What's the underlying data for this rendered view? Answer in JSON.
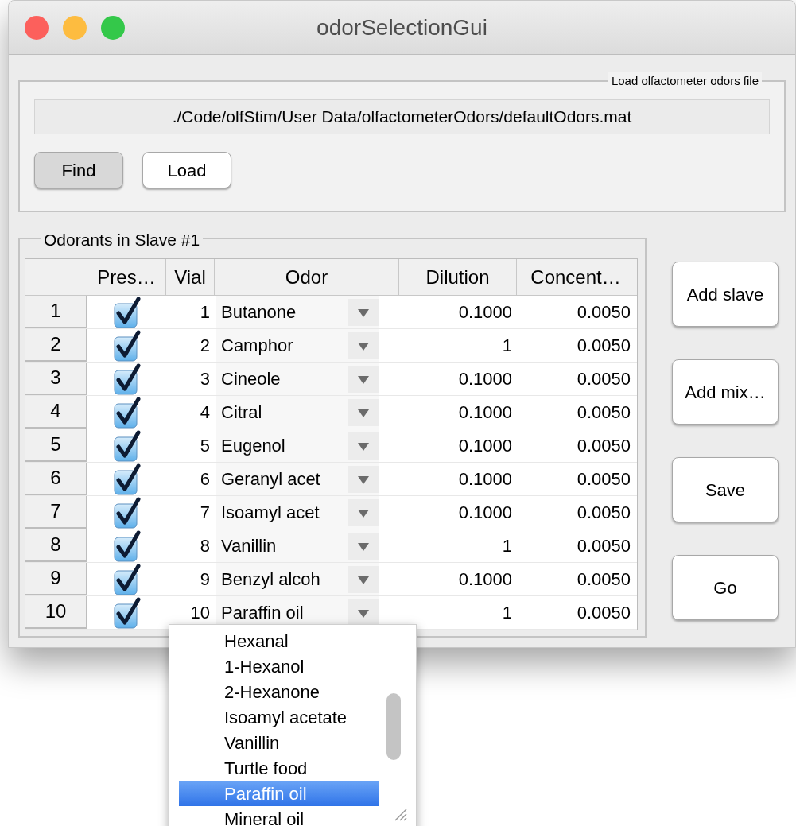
{
  "window": {
    "title": "odorSelectionGui"
  },
  "file_panel": {
    "title": "Load olfactometer odors file",
    "path": "./Code/olfStim/User Data/olfactometerOdors/defaultOdors.mat",
    "buttons": [
      {
        "label": "Find",
        "pressed": true
      },
      {
        "label": "Load",
        "pressed": false
      }
    ]
  },
  "table_panel": {
    "title": "Odorants in Slave #1",
    "columns": [
      "Pres…",
      "Vial",
      "Odor",
      "Dilution",
      "Concent…"
    ],
    "rows": [
      {
        "row": "1",
        "present": true,
        "vial": "1",
        "odor": "Butanone",
        "dilution": "0.1000",
        "concentration": "0.0050"
      },
      {
        "row": "2",
        "present": true,
        "vial": "2",
        "odor": "Camphor",
        "dilution": "1",
        "concentration": "0.0050"
      },
      {
        "row": "3",
        "present": true,
        "vial": "3",
        "odor": "Cineole",
        "dilution": "0.1000",
        "concentration": "0.0050"
      },
      {
        "row": "4",
        "present": true,
        "vial": "4",
        "odor": "Citral",
        "dilution": "0.1000",
        "concentration": "0.0050"
      },
      {
        "row": "5",
        "present": true,
        "vial": "5",
        "odor": "Eugenol",
        "dilution": "0.1000",
        "concentration": "0.0050"
      },
      {
        "row": "6",
        "present": true,
        "vial": "6",
        "odor": "Geranyl acet",
        "dilution": "0.1000",
        "concentration": "0.0050"
      },
      {
        "row": "7",
        "present": true,
        "vial": "7",
        "odor": "Isoamyl acet",
        "dilution": "0.1000",
        "concentration": "0.0050"
      },
      {
        "row": "8",
        "present": true,
        "vial": "8",
        "odor": "Vanillin",
        "dilution": "1",
        "concentration": "0.0050"
      },
      {
        "row": "9",
        "present": true,
        "vial": "9",
        "odor": "Benzyl alcoh",
        "dilution": "0.1000",
        "concentration": "0.0050"
      },
      {
        "row": "10",
        "present": true,
        "vial": "10",
        "odor": "Paraffin oil",
        "dilution": "1",
        "concentration": "0.0050"
      }
    ]
  },
  "side_buttons": [
    "Add slave",
    "Add mix…",
    "Save",
    "Go"
  ],
  "dropdown": {
    "items": [
      {
        "label": "Hexanal",
        "selected": false
      },
      {
        "label": "1-Hexanol",
        "selected": false
      },
      {
        "label": "2-Hexanone",
        "selected": false
      },
      {
        "label": "Isoamyl acetate",
        "selected": false
      },
      {
        "label": "Vanillin",
        "selected": false
      },
      {
        "label": "Turtle food",
        "selected": false
      },
      {
        "label": "Paraffin oil",
        "selected": true
      },
      {
        "label": "Mineral oil",
        "selected": false
      }
    ]
  }
}
